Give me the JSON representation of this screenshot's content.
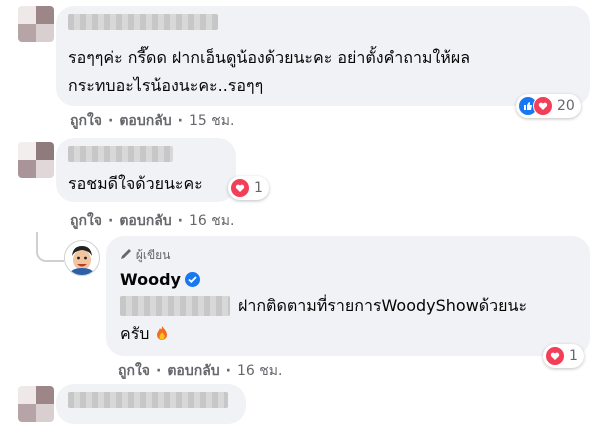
{
  "comments": [
    {
      "text_lines": [
        "รอๆๆค่ะ กรี๊ดด ฝากเอ็นดูน้องด้วยนะคะ อย่าตั้งคำถามให้ผล",
        "กระทบอะไรน้องนะคะ..รอๆๆ"
      ],
      "reactions": {
        "types": [
          "like-icon",
          "love-icon"
        ],
        "count": "20"
      },
      "actions": {
        "like": "ถูกใจ",
        "reply": "ตอบกลับ",
        "time": "15 ชม."
      }
    },
    {
      "text_lines": [
        "รอชมดีใจด้วยนะคะ"
      ],
      "reactions": {
        "types": [
          "love-icon"
        ],
        "count": "1"
      },
      "actions": {
        "like": "ถูกใจ",
        "reply": "ตอบกลับ",
        "time": "16 ชม."
      }
    }
  ],
  "reply": {
    "author_badge": "ผู้เขียน",
    "author_name": "Woody",
    "text_line1": "ฝากติดตามที่รายการWoodyShowด้วยนะ",
    "text_line2": "ครับ",
    "reactions": {
      "types": [
        "love-icon"
      ],
      "count": "1"
    },
    "actions": {
      "like": "ถูกใจ",
      "reply": "ตอบกลับ",
      "time": "16 ชม."
    }
  },
  "colors": {
    "like": "#1877f2",
    "love": "#f33e58",
    "bubble": "#f0f2f5",
    "meta": "#65676b"
  }
}
